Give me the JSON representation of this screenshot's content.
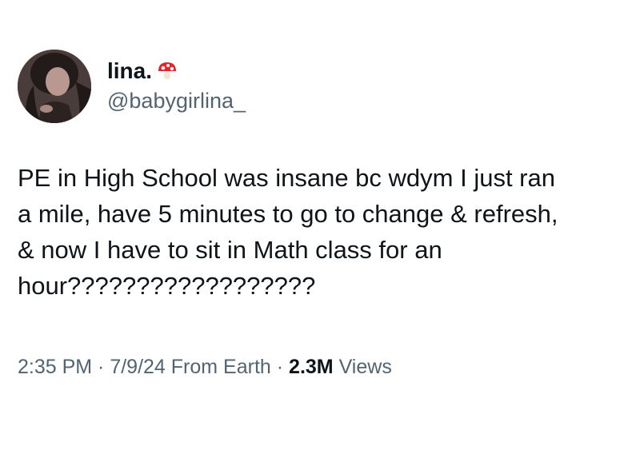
{
  "author": {
    "display_name": "lina.",
    "handle": "@babygirlina_",
    "name_emoji": "mushroom-icon",
    "avatar": "profile-photo"
  },
  "tweet": {
    "text": "PE in High School was insane bc wdym I just ran\na mile, have 5 minutes to go to change & refresh,\n& now I have to sit in Math class for an\nhour??????????????????"
  },
  "meta": {
    "time": "2:35 PM",
    "separator_1": " · ",
    "date": "7/9/24",
    "source": " From Earth",
    "separator_2": " · ",
    "views_count": "2.3M",
    "views_label": " Views"
  },
  "colors": {
    "primary_text": "#0f1419",
    "secondary_text": "#536471",
    "background": "#ffffff",
    "mushroom_red": "#e0262b"
  }
}
